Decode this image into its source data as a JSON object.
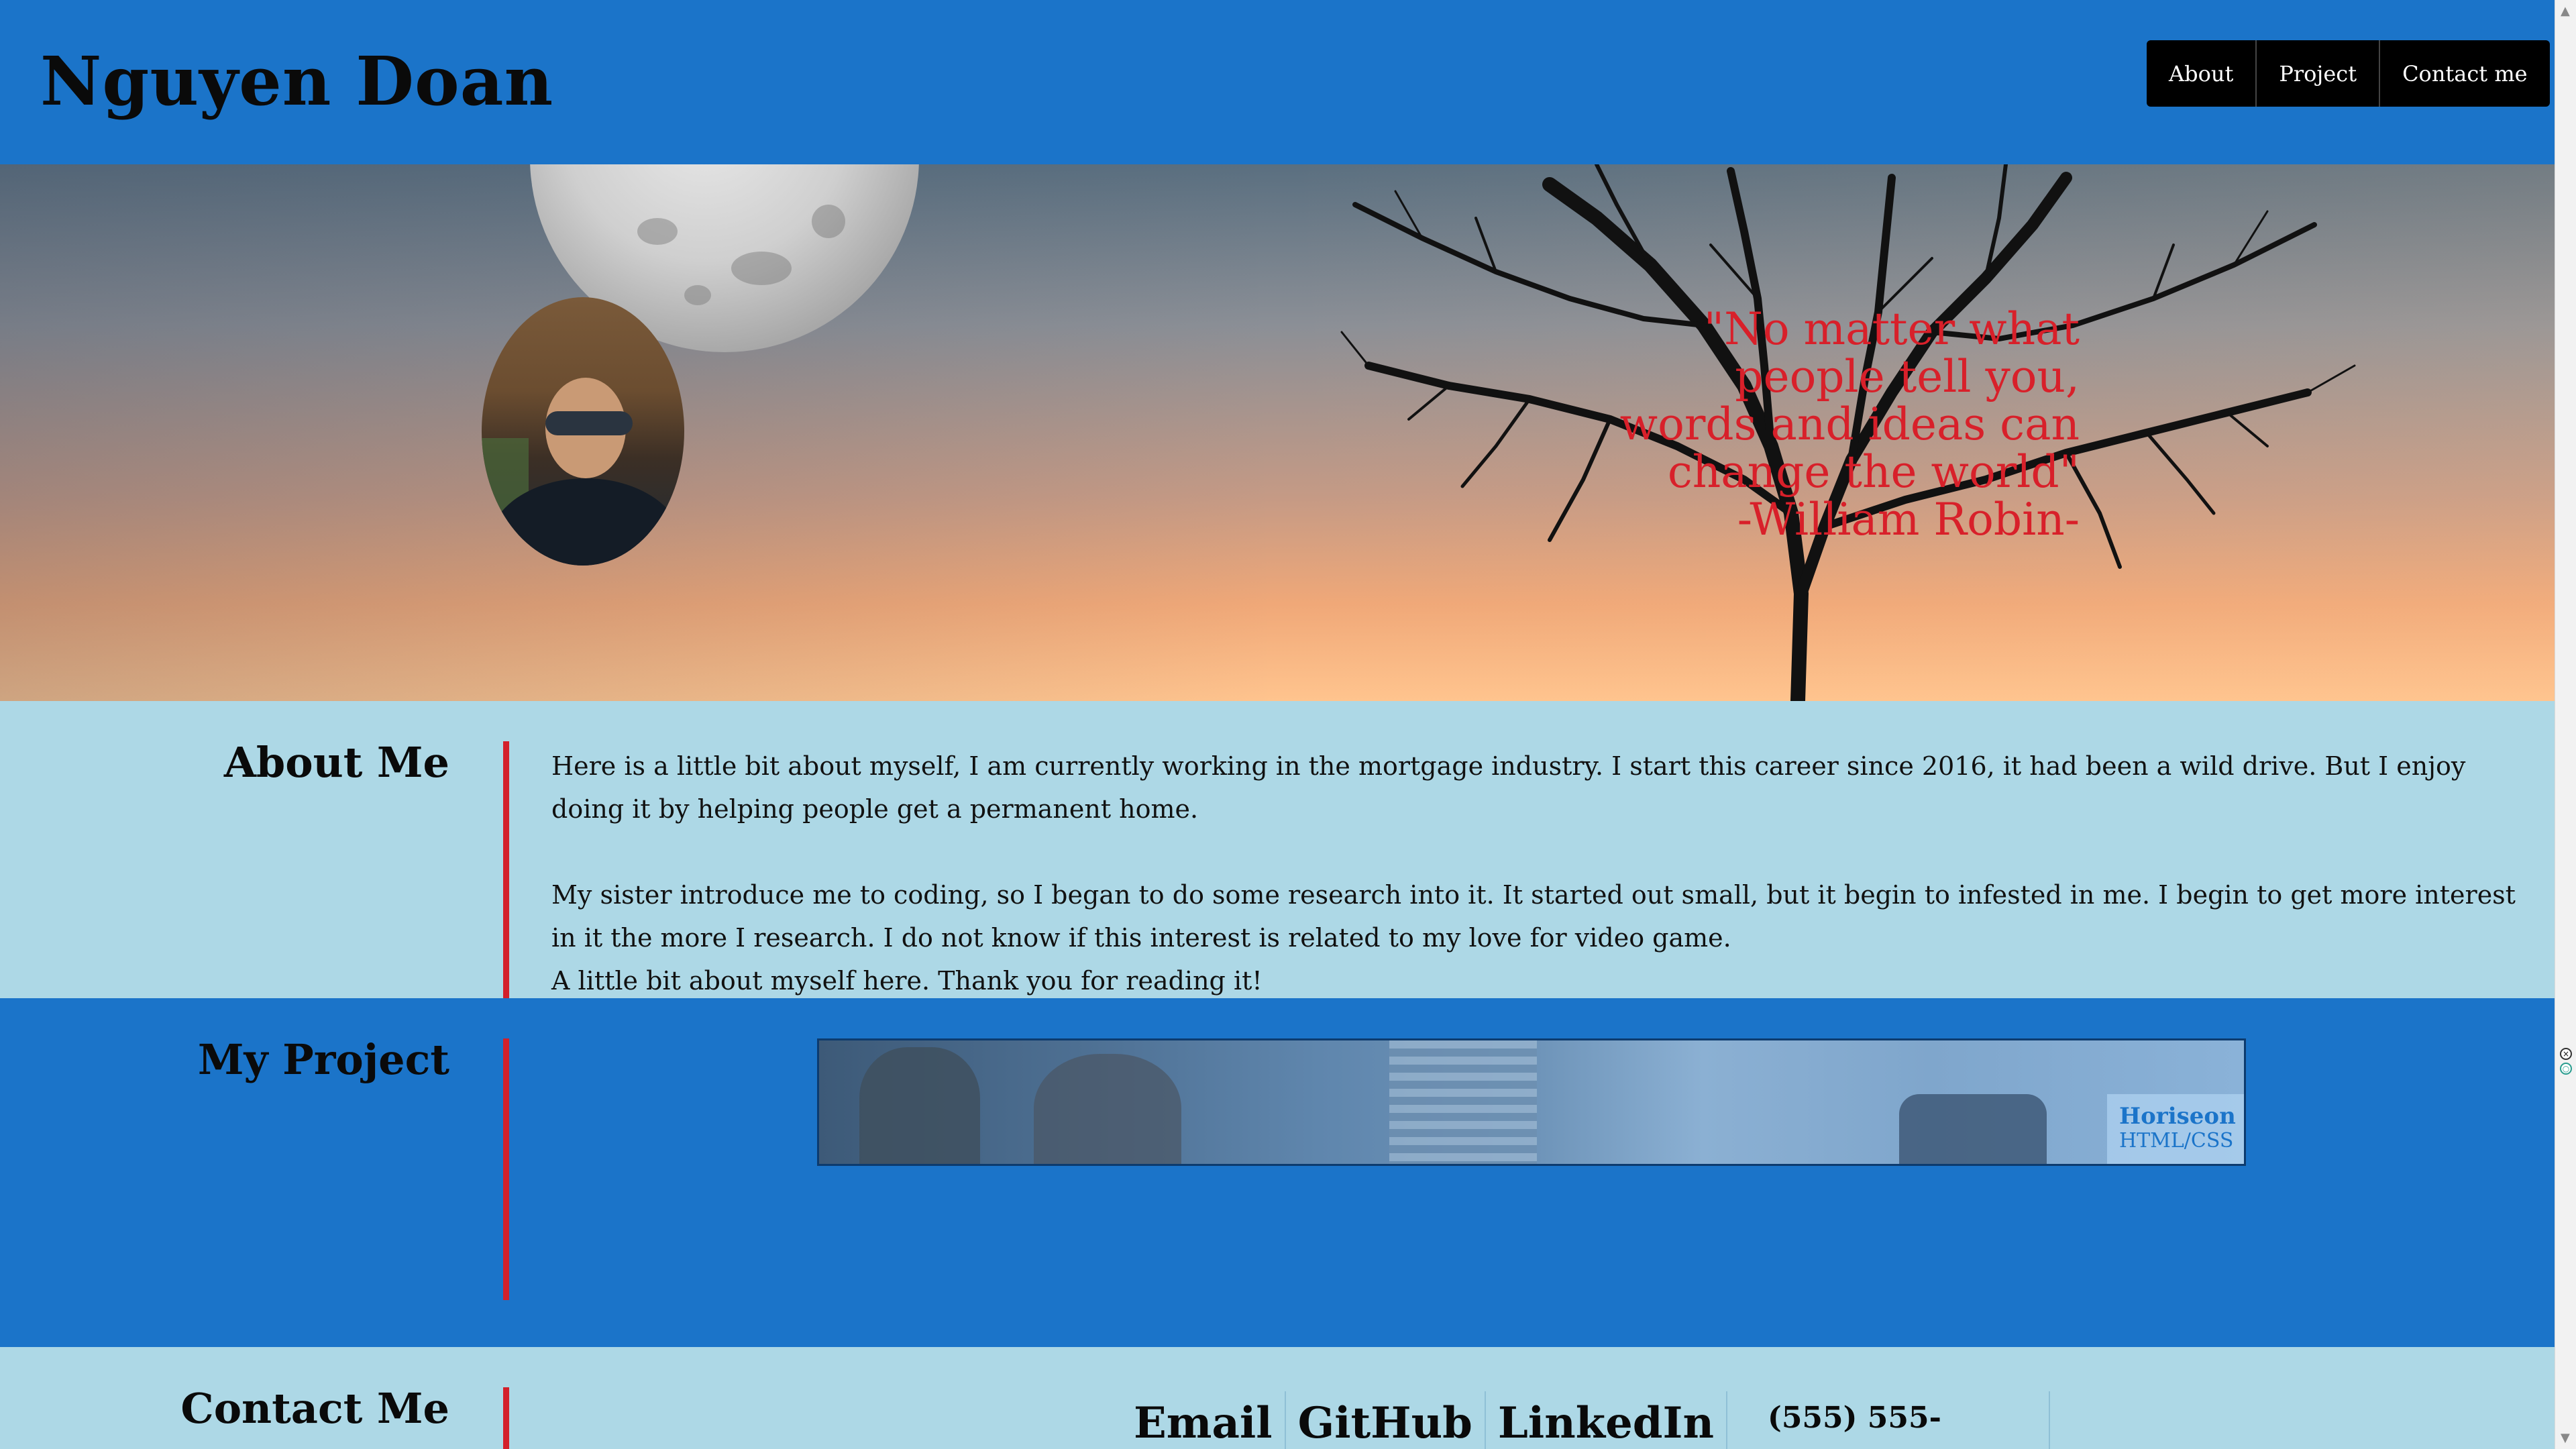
{
  "header": {
    "title": "Nguyen Doan",
    "nav": [
      {
        "label": "About"
      },
      {
        "label": "Project"
      },
      {
        "label": "Contact me"
      }
    ]
  },
  "hero": {
    "quote_lines": [
      "\"No matter what",
      "people tell you,",
      "words and ideas can",
      "change the world\"",
      "-William Robin-"
    ],
    "quote_color": "#d8202a",
    "background": "sunset-sky-with-moon-and-bare-tree",
    "avatar_icon": "profile-photo"
  },
  "about": {
    "title": "About Me",
    "paragraph_1": "Here is a little bit about myself, I am currently working in the mortgage industry. I start this career since 2016, it had been a wild drive. But I enjoy doing it by helping people get a permanent home.",
    "paragraph_2": "My sister introduce me to coding, so I began to do some research into it. It started out small, but it begin to infested in me. I begin to get more interest in it the more I research. I do not know if this interest is related to my love for video game.",
    "paragraph_3": "A little bit about myself here. Thank you for reading it!"
  },
  "project": {
    "title": "My Project",
    "card": {
      "name": "Horiseon",
      "tech": "HTML/CSS"
    }
  },
  "contact": {
    "title": "Contact Me",
    "links": [
      {
        "label": "Email"
      },
      {
        "label": "GitHub"
      },
      {
        "label": "LinkedIn"
      }
    ],
    "phone": "(555) 555-"
  },
  "colors": {
    "header_bg": "#1b74c9",
    "light_bg": "#add8e6",
    "accent_red": "#d3202b",
    "nav_bg": "#000000"
  }
}
